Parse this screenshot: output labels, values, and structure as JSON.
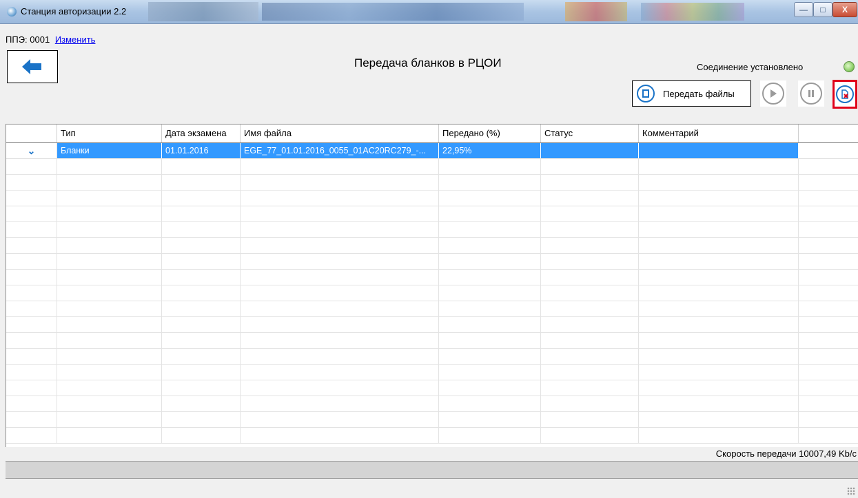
{
  "window": {
    "title": "Станция авторизации 2.2",
    "min": "—",
    "max": "□",
    "close": "X"
  },
  "ppe": {
    "label": "ППЭ: 0001",
    "change_link": "Изменить"
  },
  "page": {
    "title": "Передача бланков в РЦОИ"
  },
  "connection": {
    "status": "Соединение установлено",
    "color": "#8fd06a"
  },
  "toolbar": {
    "send_label": "Передать файлы"
  },
  "table": {
    "columns": [
      "Тип",
      "Дата экзамена",
      "Имя файла",
      "Передано (%)",
      "Статус",
      "Комментарий"
    ],
    "rows": [
      {
        "expand": "⌄",
        "type": "Бланки",
        "date": "01.01.2016",
        "filename": "EGE_77_01.01.2016_0055_01AC20RC279_-...",
        "transferred": "22,95%",
        "status": "",
        "comment": ""
      }
    ],
    "selected_color": "#3399ff"
  },
  "footer": {
    "speed": "Скорость передачи 10007,49 Kb/c"
  }
}
